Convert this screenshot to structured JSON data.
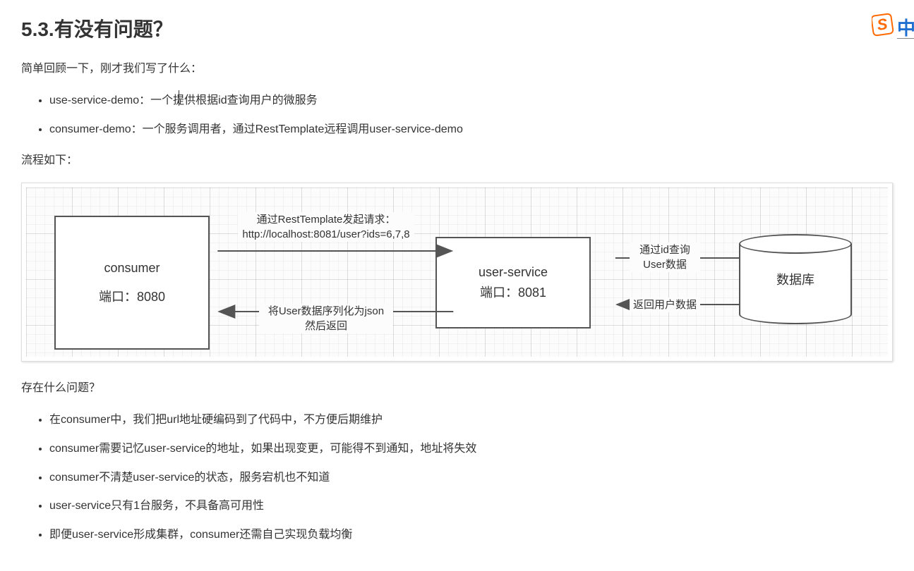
{
  "heading": "5.3.有没有问题？",
  "intro": "简单回顾一下，刚才我们写了什么：",
  "summary_list": [
    "use-service-demo：一个提供根据id查询用户的微服务",
    "consumer-demo：一个服务调用者，通过RestTemplate远程调用user-service-demo"
  ],
  "flow_label": "流程如下：",
  "diagram": {
    "consumer": {
      "title": "consumer",
      "port": "端口：8080"
    },
    "user_service": {
      "title": "user-service",
      "port": "端口：8081"
    },
    "database": "数据库",
    "arrow_req1_l1": "通过RestTemplate发起请求：",
    "arrow_req1_l2": "http://localhost:8081/user?ids=6,7,8",
    "arrow_resp1_l1": "将User数据序列化为json",
    "arrow_resp1_l2": "然后返回",
    "arrow_req2_l1": "通过id查询",
    "arrow_req2_l2": "User数据",
    "arrow_resp2": "返回用户数据"
  },
  "problems_intro": "存在什么问题？",
  "problems": [
    "在consumer中，我们把url地址硬编码到了代码中，不方便后期维护",
    "consumer需要记忆user-service的地址，如果出现变更，可能得不到通知，地址将失效",
    "consumer不清楚user-service的状态，服务宕机也不知道",
    "user-service只有1台服务，不具备高可用性",
    "即便user-service形成集群，consumer还需自己实现负载均衡"
  ],
  "ime": {
    "s": "S",
    "text": "中"
  }
}
